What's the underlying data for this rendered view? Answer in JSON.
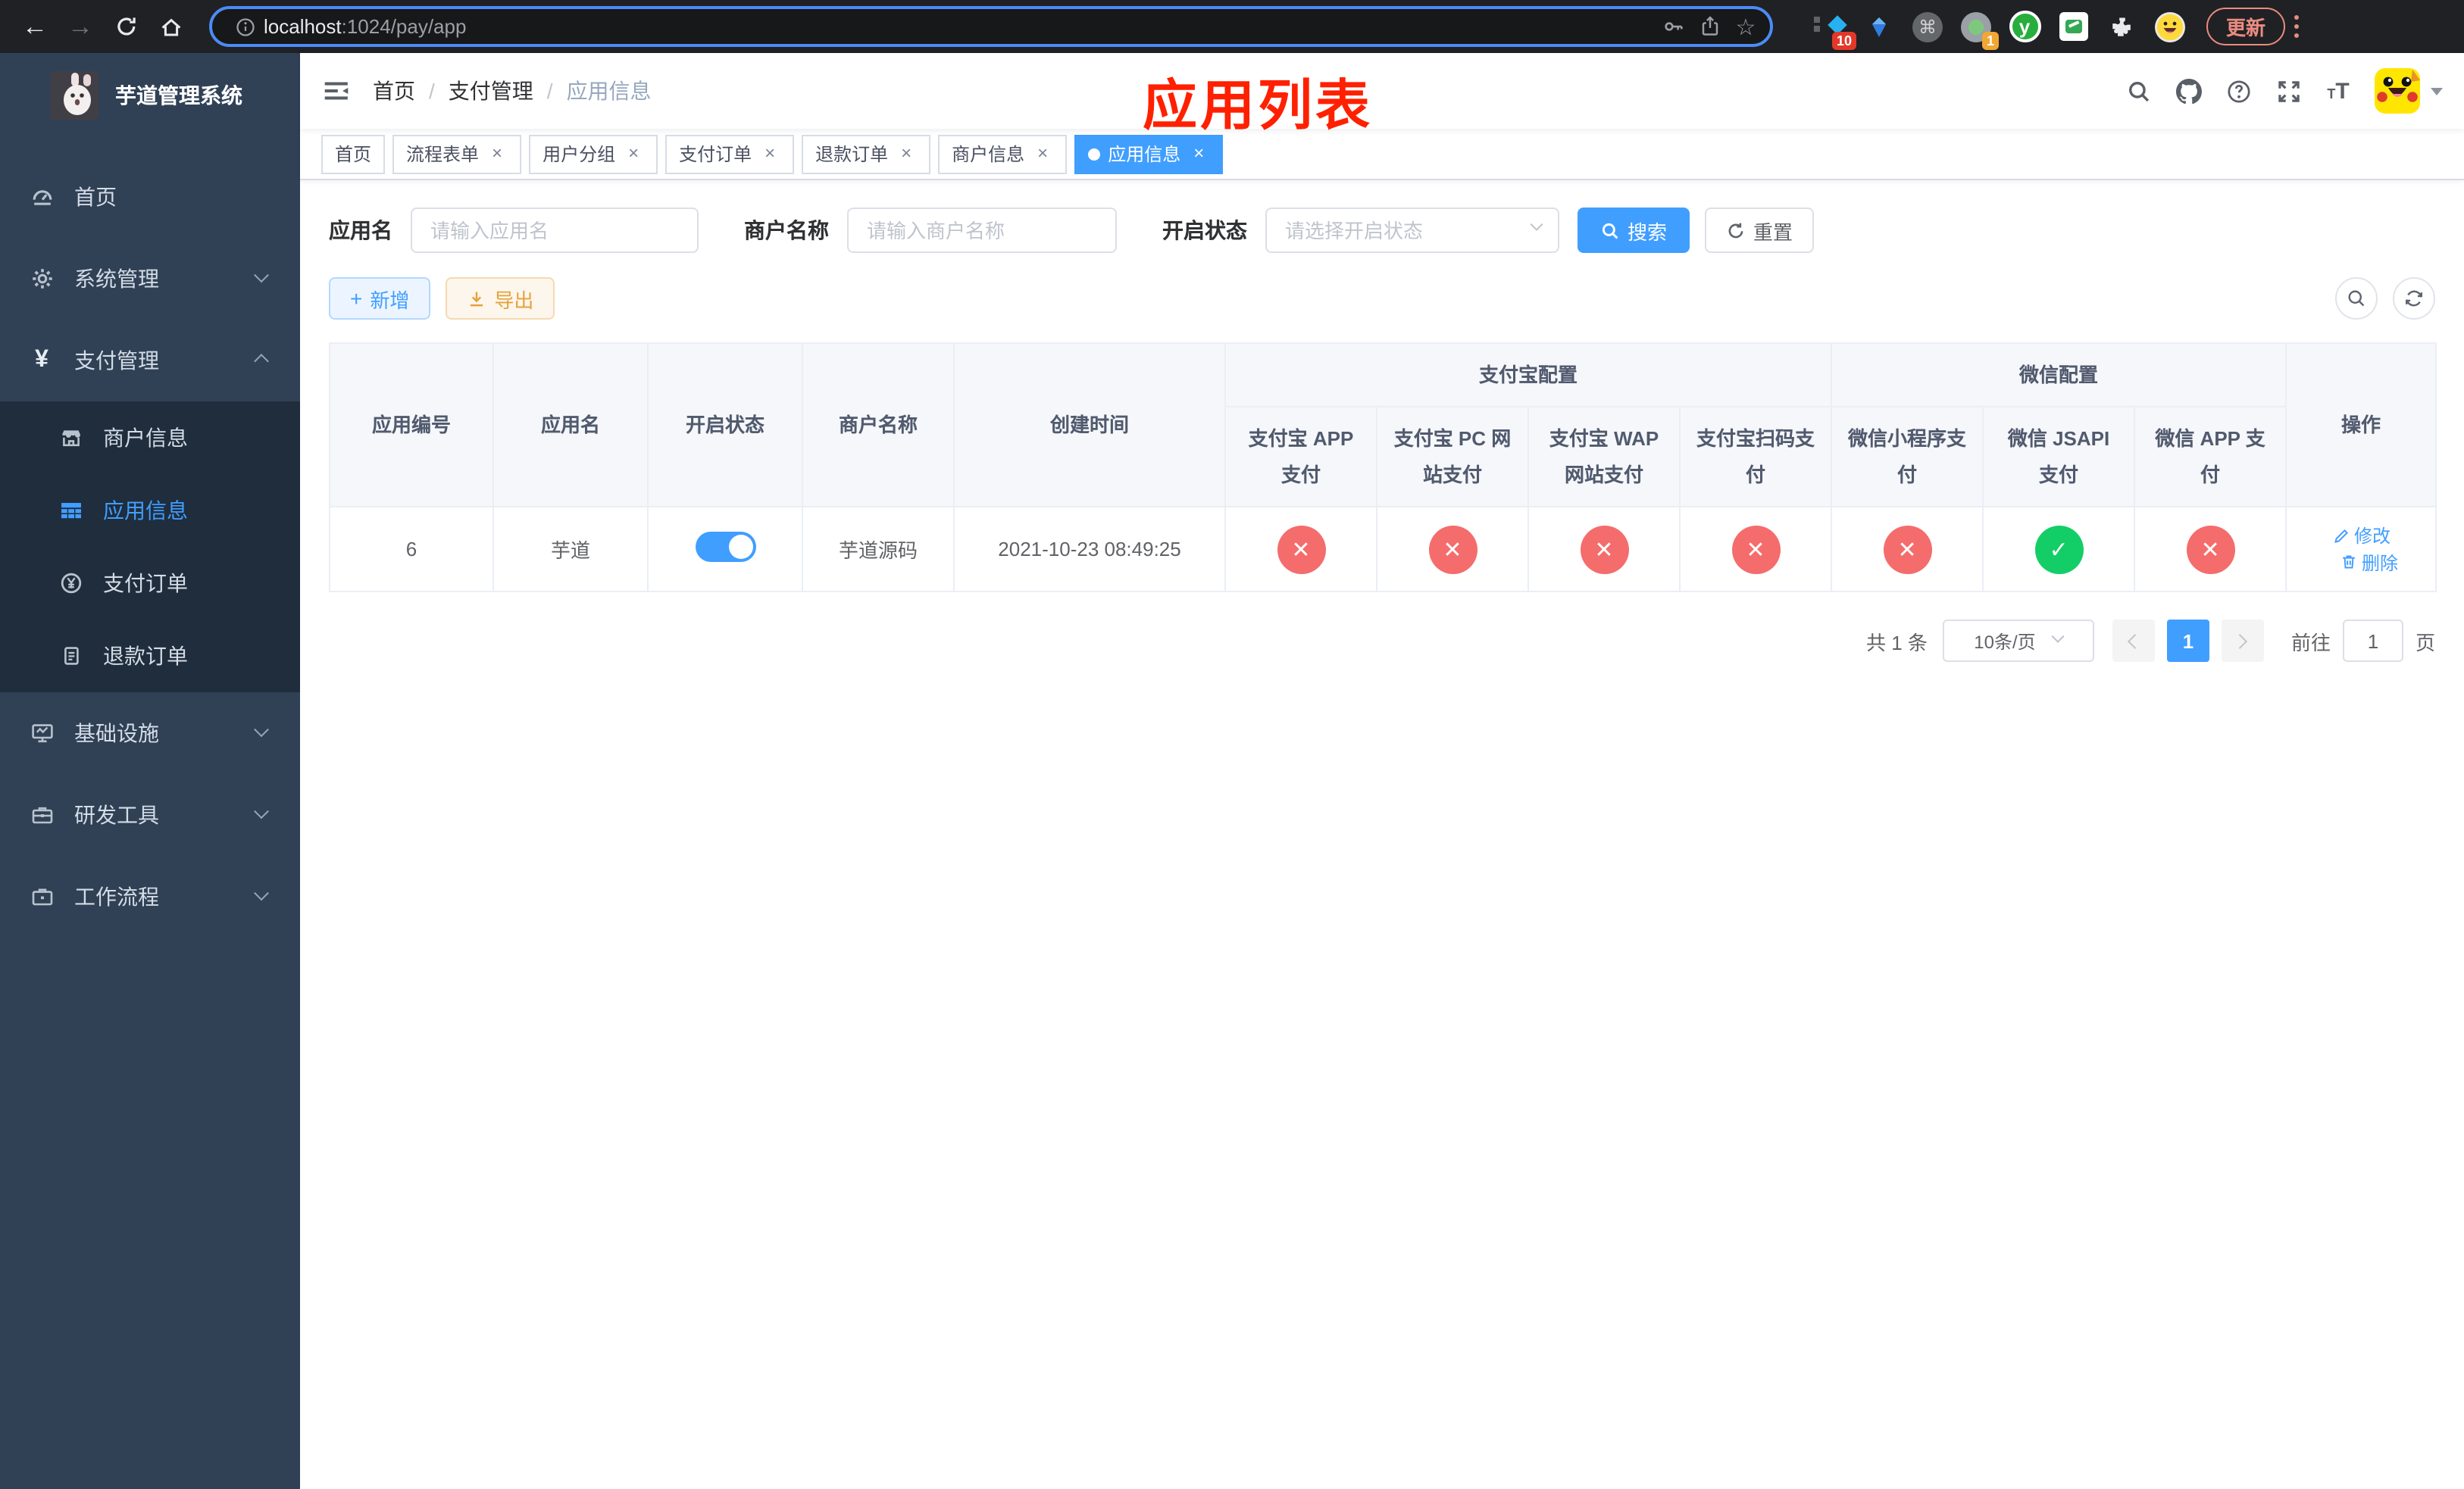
{
  "colors": {
    "primary": "#409eff",
    "danger": "#f56c6c",
    "success": "#13ce66",
    "warning": "#e6a23c"
  },
  "ui": {
    "close_glyph": "×",
    "breadcrumb_separator": "/"
  },
  "browser": {
    "url_host": "localhost",
    "url_path": ":1024/pay/app",
    "update_label": "更新",
    "ext_badge_blue_diamond": "10",
    "ext_badge_camera": "1"
  },
  "sidebar": {
    "app_title": "芋道管理系统",
    "menu": [
      {
        "label": "首页"
      },
      {
        "label": "系统管理"
      },
      {
        "label": "支付管理",
        "children": [
          {
            "label": "商户信息"
          },
          {
            "label": "应用信息",
            "active": true
          },
          {
            "label": "支付订单"
          },
          {
            "label": "退款订单"
          }
        ]
      },
      {
        "label": "基础设施"
      },
      {
        "label": "研发工具"
      },
      {
        "label": "工作流程"
      }
    ]
  },
  "navbar": {
    "breadcrumb": [
      {
        "label": "首页"
      },
      {
        "label": "支付管理"
      },
      {
        "label": "应用信息"
      }
    ],
    "annotation": "应用列表"
  },
  "tags": [
    {
      "label": "首页"
    },
    {
      "label": "流程表单"
    },
    {
      "label": "用户分组"
    },
    {
      "label": "支付订单"
    },
    {
      "label": "退款订单"
    },
    {
      "label": "商户信息"
    },
    {
      "label": "应用信息",
      "active": true
    }
  ],
  "filter": {
    "app_name_label": "应用名",
    "app_name_placeholder": "请输入应用名",
    "merchant_label": "商户名称",
    "merchant_placeholder": "请输入商户名称",
    "status_label": "开启状态",
    "status_placeholder": "请选择开启状态",
    "search_label": "搜索",
    "reset_label": "重置"
  },
  "toolbar": {
    "add_label": "新增",
    "export_label": "导出"
  },
  "table": {
    "columns": [
      "应用编号",
      "应用名",
      "开启状态",
      "商户名称",
      "创建时间"
    ],
    "group_alipay": "支付宝配置",
    "group_wechat": "微信配置",
    "pay_columns": [
      "支付宝 APP 支付",
      "支付宝 PC 网站支付",
      "支付宝 WAP 网站支付",
      "支付宝扫码支付",
      "微信小程序支付",
      "微信 JSAPI 支付",
      "微信 APP 支付"
    ],
    "action_column": "操作",
    "rows": [
      {
        "id": "6",
        "name": "芋道",
        "enabled": true,
        "merchant": "芋道源码",
        "created": "2021-10-23 08:49:25",
        "pay_status": [
          false,
          false,
          false,
          false,
          false,
          true,
          false
        ],
        "edit_label": "修改",
        "delete_label": "删除"
      }
    ]
  },
  "pagination": {
    "total": "共 1 条",
    "page_size": "10条/页",
    "current_page": "1",
    "goto_label": "前往",
    "goto_value": "1",
    "page_unit": "页"
  }
}
